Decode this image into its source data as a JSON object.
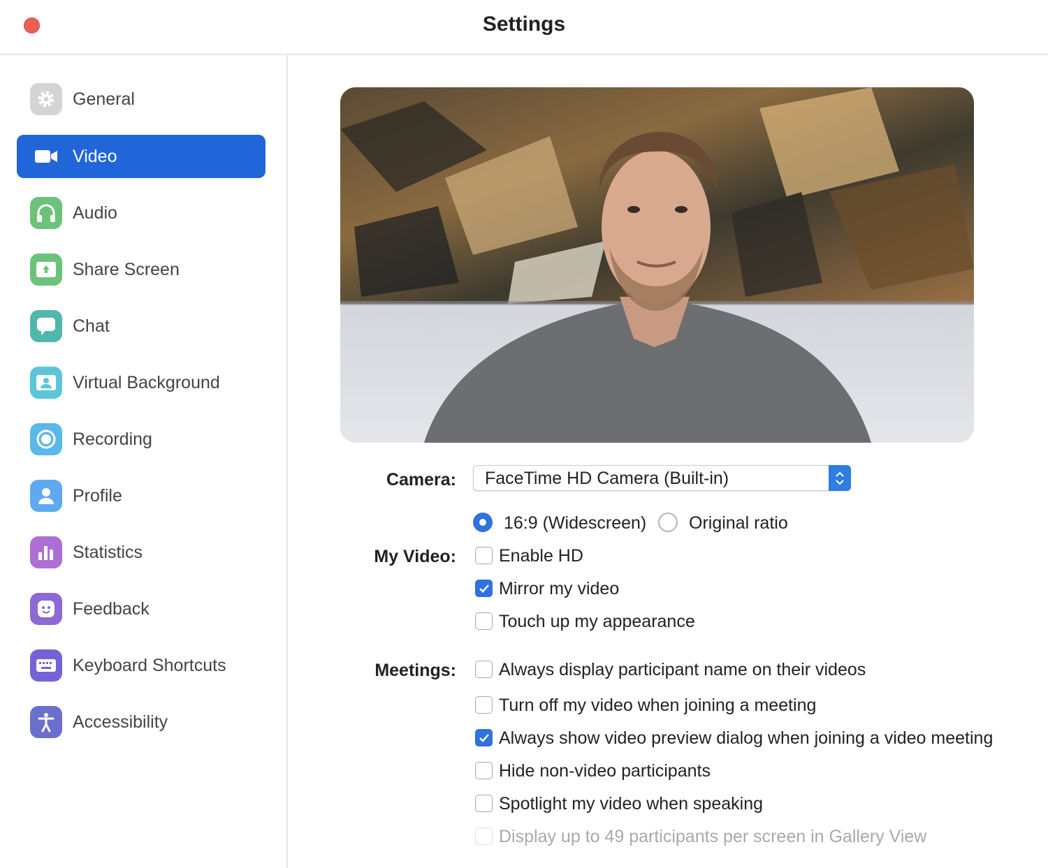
{
  "window": {
    "title": "Settings"
  },
  "sidebar": {
    "items": [
      {
        "label": "General",
        "icon": "gear-icon",
        "color": "#d4d4d4"
      },
      {
        "label": "Video",
        "icon": "video-camera-icon",
        "color": "#2166d9",
        "active": true
      },
      {
        "label": "Audio",
        "icon": "headphones-icon",
        "color": "#6cc27a"
      },
      {
        "label": "Share Screen",
        "icon": "share-screen-icon",
        "color": "#6cc27a"
      },
      {
        "label": "Chat",
        "icon": "chat-bubble-icon",
        "color": "#4fb8aa"
      },
      {
        "label": "Virtual Background",
        "icon": "virtual-background-icon",
        "color": "#5cc6d8"
      },
      {
        "label": "Recording",
        "icon": "record-icon",
        "color": "#5bb8ea"
      },
      {
        "label": "Profile",
        "icon": "profile-icon",
        "color": "#5ea9f0"
      },
      {
        "label": "Statistics",
        "icon": "bar-chart-icon",
        "color": "#ad6fd1"
      },
      {
        "label": "Feedback",
        "icon": "smiley-icon",
        "color": "#8e68d4"
      },
      {
        "label": "Keyboard Shortcuts",
        "icon": "keyboard-icon",
        "color": "#7264d6"
      },
      {
        "label": "Accessibility",
        "icon": "accessibility-icon",
        "color": "#6a6fce"
      }
    ]
  },
  "video": {
    "camera_label": "Camera:",
    "camera_value": "FaceTime HD Camera (Built-in)",
    "ratio_widescreen": "16:9 (Widescreen)",
    "ratio_original": "Original ratio",
    "ratio_selected": "16:9 (Widescreen)",
    "my_video_label": "My Video:",
    "my_video_options": [
      {
        "label": "Enable HD",
        "checked": false
      },
      {
        "label": "Mirror my video",
        "checked": true
      },
      {
        "label": "Touch up my appearance",
        "checked": false
      }
    ],
    "meetings_label": "Meetings:",
    "meetings_options": [
      {
        "label": "Always display participant name on their videos",
        "checked": false
      },
      {
        "label": "Turn off my video when joining a meeting",
        "checked": false
      },
      {
        "label": "Always show video preview dialog when joining a video meeting",
        "checked": true
      },
      {
        "label": "Hide non-video participants",
        "checked": false
      },
      {
        "label": "Spotlight my video when speaking",
        "checked": false
      },
      {
        "label": "Display up to 49 participants per screen in Gallery View",
        "checked": false,
        "disabled": true
      }
    ]
  },
  "colors": {
    "accent": "#2f72e0",
    "sidebar_active": "#2166d9",
    "close_button": "#ec5f54"
  }
}
